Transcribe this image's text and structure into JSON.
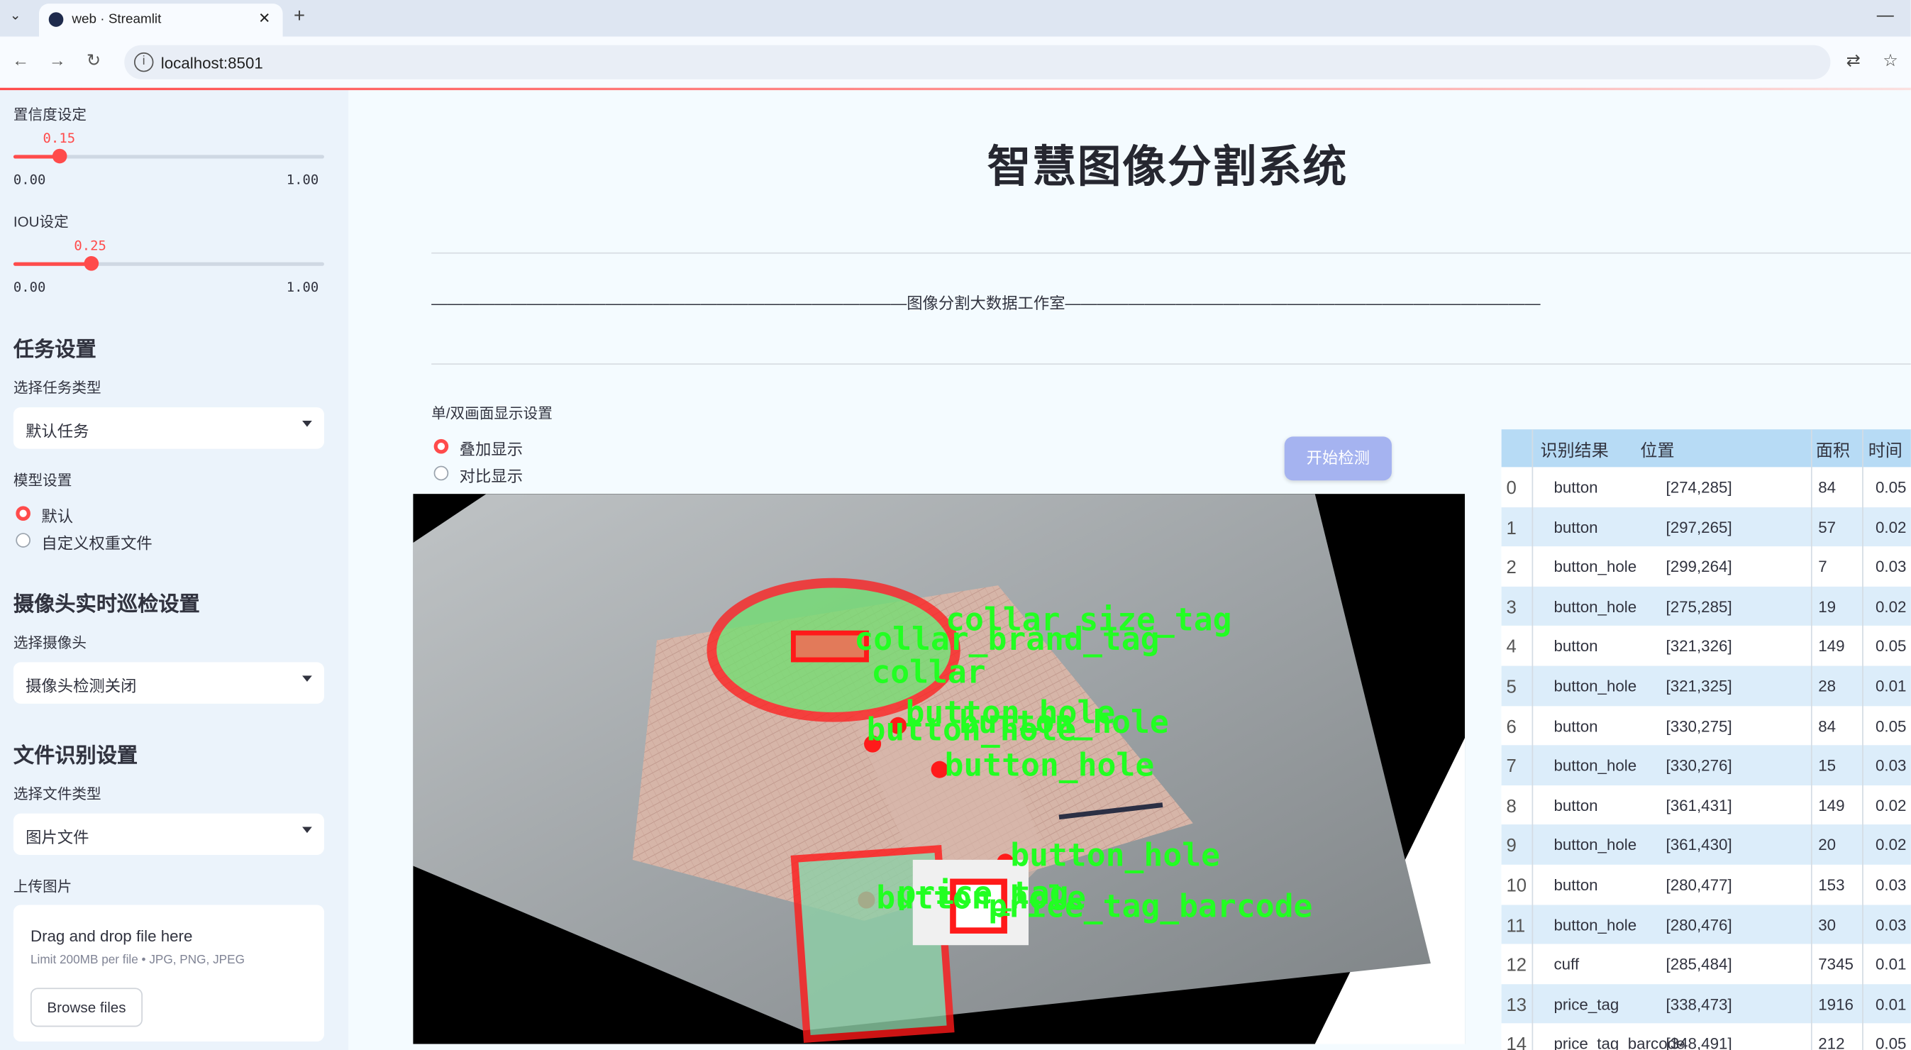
{
  "browser": {
    "tab_title": "web · Streamlit",
    "url": "localhost:8501"
  },
  "sidebar": {
    "conf": {
      "label": "置信度设定",
      "value": 0.15,
      "value_text": "0.15",
      "min": "0.00",
      "max": "1.00"
    },
    "iou": {
      "label": "IOU设定",
      "value": 0.25,
      "value_text": "0.25",
      "min": "0.00",
      "max": "1.00"
    },
    "task_header": "任务设置",
    "task_type_label": "选择任务类型",
    "task_type_value": "默认任务",
    "model_label": "模型设置",
    "model_options": [
      "默认",
      "自定义权重文件"
    ],
    "model_selected": 0,
    "camera_header": "摄像头实时巡检设置",
    "camera_label": "选择摄像头",
    "camera_value": "摄像头检测关闭",
    "file_header": "文件识别设置",
    "file_type_label": "选择文件类型",
    "file_type_value": "图片文件",
    "upload_label": "上传图片",
    "upload_drop": "Drag and drop file here",
    "upload_limit": "Limit 200MB per file • JPG, PNG, JPEG",
    "upload_button": "Browse files"
  },
  "main": {
    "title": "智慧图像分割系统",
    "banner": "——————————————————————————————图像分割大数据工作室——————————————————————————————",
    "display_label": "单/双画面显示设置",
    "display_options": [
      "叠加显示",
      "对比显示"
    ],
    "display_selected": 0,
    "detect_button": "开始检测"
  },
  "image_labels": [
    "collar_size_tag",
    "collar_brand_tag",
    "collar",
    "button_hole",
    "button_hole",
    "button_hole",
    "button_hole",
    "button_hole",
    "button_hole",
    "price_tag",
    "price_tag_barcode"
  ],
  "table": {
    "columns": [
      "识别结果",
      "位置",
      "面积",
      "时间"
    ],
    "rows": [
      {
        "i": "0",
        "result": "button",
        "pos": "[274,285]",
        "area": "84",
        "time": "0.05"
      },
      {
        "i": "1",
        "result": "button",
        "pos": "[297,265]",
        "area": "57",
        "time": "0.02"
      },
      {
        "i": "2",
        "result": "button_hole",
        "pos": "[299,264]",
        "area": "7",
        "time": "0.03"
      },
      {
        "i": "3",
        "result": "button_hole",
        "pos": "[275,285]",
        "area": "19",
        "time": "0.02"
      },
      {
        "i": "4",
        "result": "button",
        "pos": "[321,326]",
        "area": "149",
        "time": "0.05"
      },
      {
        "i": "5",
        "result": "button_hole",
        "pos": "[321,325]",
        "area": "28",
        "time": "0.01"
      },
      {
        "i": "6",
        "result": "button",
        "pos": "[330,275]",
        "area": "84",
        "time": "0.05"
      },
      {
        "i": "7",
        "result": "button_hole",
        "pos": "[330,276]",
        "area": "15",
        "time": "0.03"
      },
      {
        "i": "8",
        "result": "button",
        "pos": "[361,431]",
        "area": "149",
        "time": "0.02"
      },
      {
        "i": "9",
        "result": "button_hole",
        "pos": "[361,430]",
        "area": "20",
        "time": "0.02"
      },
      {
        "i": "10",
        "result": "button",
        "pos": "[280,477]",
        "area": "153",
        "time": "0.03"
      },
      {
        "i": "11",
        "result": "button_hole",
        "pos": "[280,476]",
        "area": "30",
        "time": "0.03"
      },
      {
        "i": "12",
        "result": "cuff",
        "pos": "[285,484]",
        "area": "7345",
        "time": "0.01"
      },
      {
        "i": "13",
        "result": "price_tag",
        "pos": "[338,473]",
        "area": "1916",
        "time": "0.01"
      },
      {
        "i": "14",
        "result": "price_tag_barcode",
        "pos": "[348,491]",
        "area": "212",
        "time": "0.05"
      }
    ]
  },
  "colors": {
    "accent": "#ff4b4b",
    "detect_button": "#a5b3f0",
    "mask_green": "#33dd33",
    "mask_red": "#ff1a1a"
  }
}
